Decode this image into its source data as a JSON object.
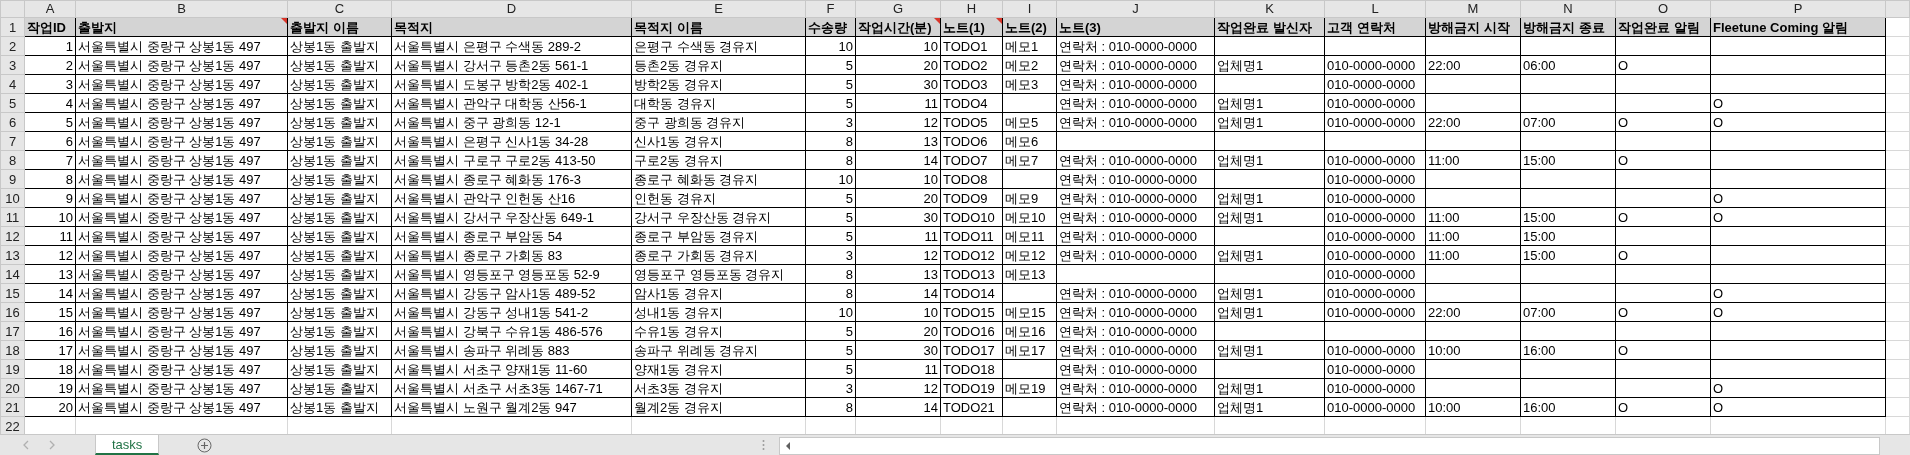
{
  "columns": [
    {
      "letter": "A",
      "header": "작업ID",
      "numeric": true,
      "has_comment": false
    },
    {
      "letter": "B",
      "header": "출발지",
      "numeric": false,
      "has_comment": true
    },
    {
      "letter": "C",
      "header": "출발지 이름",
      "numeric": false,
      "has_comment": false
    },
    {
      "letter": "D",
      "header": "목적지",
      "numeric": false,
      "has_comment": false
    },
    {
      "letter": "E",
      "header": "목적지 이름",
      "numeric": false,
      "has_comment": false
    },
    {
      "letter": "F",
      "header": "수송량",
      "numeric": true,
      "has_comment": false
    },
    {
      "letter": "G",
      "header": "작업시간(분)",
      "numeric": true,
      "has_comment": true
    },
    {
      "letter": "H",
      "header": "노트(1)",
      "numeric": false,
      "has_comment": true
    },
    {
      "letter": "I",
      "header": "노트(2)",
      "numeric": false,
      "has_comment": false
    },
    {
      "letter": "J",
      "header": "노트(3)",
      "numeric": false,
      "has_comment": false
    },
    {
      "letter": "K",
      "header": "작업완료 발신자",
      "numeric": false,
      "has_comment": false
    },
    {
      "letter": "L",
      "header": "고객 연락처",
      "numeric": false,
      "has_comment": false
    },
    {
      "letter": "M",
      "header": "방해금지 시작",
      "numeric": false,
      "has_comment": false
    },
    {
      "letter": "N",
      "header": "방해금지 종료",
      "numeric": false,
      "has_comment": false
    },
    {
      "letter": "O",
      "header": "작업완료 알림",
      "numeric": false,
      "has_comment": false
    },
    {
      "letter": "P",
      "header": "Fleetune Coming 알림",
      "numeric": false,
      "has_comment": false
    }
  ],
  "header_row": "1",
  "rows": [
    {
      "number": "2",
      "cells": {
        "A": "1",
        "B": "서울특별시 중랑구 상봉1동 497",
        "C": "상봉1동 출발지",
        "D": "서울특별시 은평구 수색동 289-2",
        "E": "은평구 수색동 경유지",
        "F": "10",
        "G": "10",
        "H": "TODO1",
        "I": "메모1",
        "J": "연락처 : 010-0000-0000"
      }
    },
    {
      "number": "3",
      "cells": {
        "A": "2",
        "B": "서울특별시 중랑구 상봉1동 497",
        "C": "상봉1동 출발지",
        "D": "서울특별시 강서구 등촌2동 561-1",
        "E": "등촌2동 경유지",
        "F": "5",
        "G": "20",
        "H": "TODO2",
        "I": "메모2",
        "J": "연락처 : 010-0000-0000",
        "K": "업체명1",
        "L": "010-0000-0000",
        "M": "22:00",
        "N": "06:00",
        "O": "O"
      }
    },
    {
      "number": "4",
      "cells": {
        "A": "3",
        "B": "서울특별시 중랑구 상봉1동 497",
        "C": "상봉1동 출발지",
        "D": "서울특별시 도봉구 방학2동 402-1",
        "E": "방학2동 경유지",
        "F": "5",
        "G": "30",
        "H": "TODO3",
        "I": "메모3",
        "J": "연락처 : 010-0000-0000",
        "L": "010-0000-0000"
      }
    },
    {
      "number": "5",
      "cells": {
        "A": "4",
        "B": "서울특별시 중랑구 상봉1동 497",
        "C": "상봉1동 출발지",
        "D": "서울특별시 관악구 대학동 산56-1",
        "E": "대학동 경유지",
        "F": "5",
        "G": "11",
        "H": "TODO4",
        "J": "연락처 : 010-0000-0000",
        "K": "업체명1",
        "L": "010-0000-0000",
        "P": "O"
      }
    },
    {
      "number": "6",
      "cells": {
        "A": "5",
        "B": "서울특별시 중랑구 상봉1동 497",
        "C": "상봉1동 출발지",
        "D": "서울특별시 중구 광희동 12-1",
        "E": "중구 광희동 경유지",
        "F": "3",
        "G": "12",
        "H": "TODO5",
        "I": "메모5",
        "J": "연락처 : 010-0000-0000",
        "K": "업체명1",
        "L": "010-0000-0000",
        "M": "22:00",
        "N": "07:00",
        "O": "O",
        "P": "O"
      }
    },
    {
      "number": "7",
      "cells": {
        "A": "6",
        "B": "서울특별시 중랑구 상봉1동 497",
        "C": "상봉1동 출발지",
        "D": "서울특별시 은평구 신사1동 34-28",
        "E": "신사1동 경유지",
        "F": "8",
        "G": "13",
        "H": "TODO6",
        "I": "메모6"
      }
    },
    {
      "number": "8",
      "cells": {
        "A": "7",
        "B": "서울특별시 중랑구 상봉1동 497",
        "C": "상봉1동 출발지",
        "D": "서울특별시 구로구 구로2동 413-50",
        "E": "구로2동 경유지",
        "F": "8",
        "G": "14",
        "H": "TODO7",
        "I": "메모7",
        "J": "연락처 : 010-0000-0000",
        "K": "업체명1",
        "L": "010-0000-0000",
        "M": "11:00",
        "N": "15:00",
        "O": "O"
      }
    },
    {
      "number": "9",
      "cells": {
        "A": "8",
        "B": "서울특별시 중랑구 상봉1동 497",
        "C": "상봉1동 출발지",
        "D": "서울특별시 종로구 혜화동 176-3",
        "E": "종로구 혜화동 경유지",
        "F": "10",
        "G": "10",
        "H": "TODO8",
        "J": "연락처 : 010-0000-0000",
        "L": "010-0000-0000"
      }
    },
    {
      "number": "10",
      "cells": {
        "A": "9",
        "B": "서울특별시 중랑구 상봉1동 497",
        "C": "상봉1동 출발지",
        "D": "서울특별시 관악구 인헌동 산16",
        "E": "인헌동 경유지",
        "F": "5",
        "G": "20",
        "H": "TODO9",
        "I": "메모9",
        "J": "연락처 : 010-0000-0000",
        "K": "업체명1",
        "L": "010-0000-0000",
        "P": "O"
      }
    },
    {
      "number": "11",
      "cells": {
        "A": "10",
        "B": "서울특별시 중랑구 상봉1동 497",
        "C": "상봉1동 출발지",
        "D": "서울특별시 강서구 우장산동 649-1",
        "E": "강서구 우장산동 경유지",
        "F": "5",
        "G": "30",
        "H": "TODO10",
        "I": "메모10",
        "J": "연락처 : 010-0000-0000",
        "K": "업체명1",
        "L": "010-0000-0000",
        "M": "11:00",
        "N": "15:00",
        "O": "O",
        "P": "O"
      }
    },
    {
      "number": "12",
      "cells": {
        "A": "11",
        "B": "서울특별시 중랑구 상봉1동 497",
        "C": "상봉1동 출발지",
        "D": "서울특별시 종로구 부암동 54",
        "E": "종로구 부암동 경유지",
        "F": "5",
        "G": "11",
        "H": "TODO11",
        "I": "메모11",
        "J": "연락처 : 010-0000-0000",
        "L": "010-0000-0000",
        "M": "11:00",
        "N": "15:00"
      }
    },
    {
      "number": "13",
      "cells": {
        "A": "12",
        "B": "서울특별시 중랑구 상봉1동 497",
        "C": "상봉1동 출발지",
        "D": "서울특별시 종로구 가회동 83",
        "E": "종로구 가회동 경유지",
        "F": "3",
        "G": "12",
        "H": "TODO12",
        "I": "메모12",
        "J": "연락처 : 010-0000-0000",
        "K": "업체명1",
        "L": "010-0000-0000",
        "M": "11:00",
        "N": "15:00",
        "O": "O"
      }
    },
    {
      "number": "14",
      "cells": {
        "A": "13",
        "B": "서울특별시 중랑구 상봉1동 497",
        "C": "상봉1동 출발지",
        "D": "서울특별시 영등포구 영등포동 52-9",
        "E": "영등포구 영등포동 경유지",
        "F": "8",
        "G": "13",
        "H": "TODO13",
        "I": "메모13",
        "L": "010-0000-0000"
      }
    },
    {
      "number": "15",
      "cells": {
        "A": "14",
        "B": "서울특별시 중랑구 상봉1동 497",
        "C": "상봉1동 출발지",
        "D": "서울특별시 강동구 암사1동 489-52",
        "E": "암사1동 경유지",
        "F": "8",
        "G": "14",
        "H": "TODO14",
        "J": "연락처 : 010-0000-0000",
        "K": "업체명1",
        "L": "010-0000-0000",
        "P": "O"
      }
    },
    {
      "number": "16",
      "cells": {
        "A": "15",
        "B": "서울특별시 중랑구 상봉1동 497",
        "C": "상봉1동 출발지",
        "D": "서울특별시 강동구 성내1동 541-2",
        "E": "성내1동 경유지",
        "F": "10",
        "G": "10",
        "H": "TODO15",
        "I": "메모15",
        "J": "연락처 : 010-0000-0000",
        "K": "업체명1",
        "L": "010-0000-0000",
        "M": "22:00",
        "N": "07:00",
        "O": "O",
        "P": "O"
      }
    },
    {
      "number": "17",
      "cells": {
        "A": "16",
        "B": "서울특별시 중랑구 상봉1동 497",
        "C": "상봉1동 출발지",
        "D": "서울특별시 강북구 수유1동 486-576",
        "E": "수유1동 경유지",
        "F": "5",
        "G": "20",
        "H": "TODO16",
        "I": "메모16",
        "J": "연락처 : 010-0000-0000"
      }
    },
    {
      "number": "18",
      "cells": {
        "A": "17",
        "B": "서울특별시 중랑구 상봉1동 497",
        "C": "상봉1동 출발지",
        "D": "서울특별시 송파구 위례동 883",
        "E": "송파구 위례동 경유지",
        "F": "5",
        "G": "30",
        "H": "TODO17",
        "I": "메모17",
        "J": "연락처 : 010-0000-0000",
        "K": "업체명1",
        "L": "010-0000-0000",
        "M": "10:00",
        "N": "16:00",
        "O": "O"
      }
    },
    {
      "number": "19",
      "cells": {
        "A": "18",
        "B": "서울특별시 중랑구 상봉1동 497",
        "C": "상봉1동 출발지",
        "D": "서울특별시 서초구 양재1동 11-60",
        "E": "양재1동 경유지",
        "F": "5",
        "G": "11",
        "H": "TODO18",
        "J": "연락처 : 010-0000-0000",
        "L": "010-0000-0000"
      }
    },
    {
      "number": "20",
      "cells": {
        "A": "19",
        "B": "서울특별시 중랑구 상봉1동 497",
        "C": "상봉1동 출발지",
        "D": "서울특별시 서초구 서초3동 1467-71",
        "E": "서초3동 경유지",
        "F": "3",
        "G": "12",
        "H": "TODO19",
        "I": "메모19",
        "J": "연락처 : 010-0000-0000",
        "K": "업체명1",
        "L": "010-0000-0000",
        "P": "O"
      }
    },
    {
      "number": "21",
      "cells": {
        "A": "20",
        "B": "서울특별시 중랑구 상봉1동 497",
        "C": "상봉1동 출발지",
        "D": "서울특별시 노원구 월계2동 947",
        "E": "월계2동 경유지",
        "F": "8",
        "G": "14",
        "H": "TODO21",
        "J": "연락처 : 010-0000-0000",
        "K": "업체명1",
        "L": "010-0000-0000",
        "M": "10:00",
        "N": "16:00",
        "O": "O",
        "P": "O"
      }
    },
    {
      "number": "22",
      "cells": {}
    }
  ],
  "sheet_tabs": [
    {
      "label": "tasks",
      "selected": true
    }
  ]
}
